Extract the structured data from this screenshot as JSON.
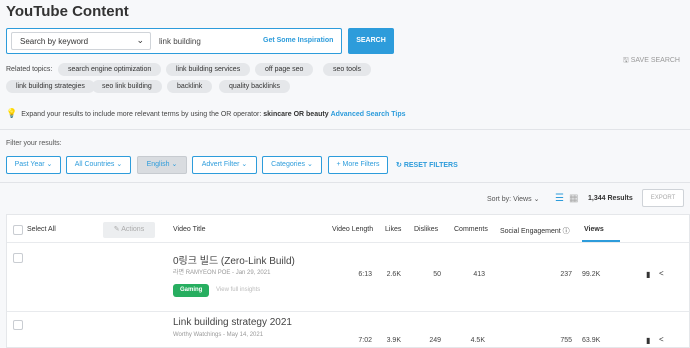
{
  "page_title": "YouTube Content",
  "search": {
    "mode_label": "Search by keyword",
    "keyword": "link building",
    "inspiration_label": "Get Some Inspiration",
    "button_label": "SEARCH",
    "save_label": "SAVE SEARCH"
  },
  "related": {
    "label": "Related topics:",
    "topics": [
      "search engine optimization",
      "link building services",
      "off page seo",
      "seo tools",
      "link building strategies",
      "seo link building",
      "backlink",
      "quality backlinks"
    ]
  },
  "tip": {
    "text": "Expand your results to include more relevant terms by using the OR operator:",
    "example": "skincare OR beauty",
    "link": "Advanced Search Tips"
  },
  "filters": {
    "label": "Filter your results:",
    "buttons": [
      "Past Year",
      "All Countries",
      "English",
      "Advert Filter",
      "Categories",
      "More Filters"
    ],
    "reset_label": "RESET FILTERS"
  },
  "sort": {
    "label": "Sort by: Views",
    "results": "1,344 Results",
    "export": "EXPORT"
  },
  "table": {
    "select_all": "Select All",
    "actions": "Actions",
    "columns": [
      "Video Title",
      "Video Length",
      "Likes",
      "Dislikes",
      "Comments",
      "Social Engagement",
      "Views"
    ],
    "rows": [
      {
        "title": "0링크 빌드 (Zero-Link Build)",
        "meta": "라면 RAMYEON POE - Jan 29, 2021",
        "badge": "Gaming",
        "insight": "View full insights",
        "length": "6:13",
        "likes": "2.6K",
        "dislikes": "50",
        "comments": "413",
        "social": "237",
        "views": "99.2K"
      },
      {
        "title": "Link building strategy 2021",
        "meta": "Worthy Watchings - May 14, 2021",
        "length": "7:02",
        "likes": "3.9K",
        "dislikes": "249",
        "comments": "4.5K",
        "social": "755",
        "views": "63.9K"
      }
    ]
  },
  "colors": {
    "accent": "#2d9cdb",
    "badge": "#27ae60"
  }
}
